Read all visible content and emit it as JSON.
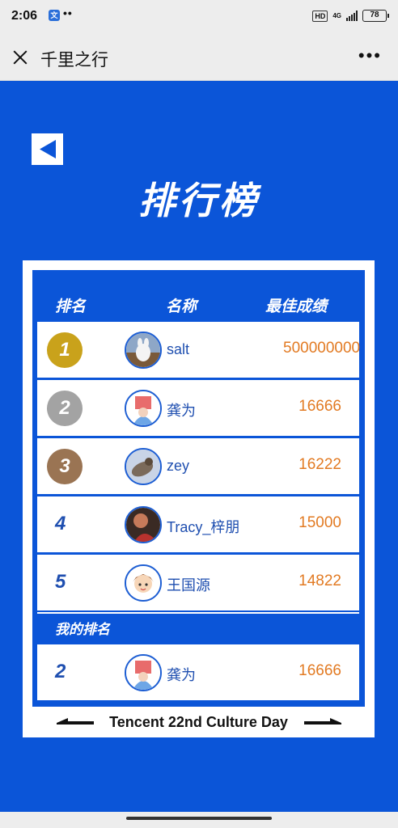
{
  "status": {
    "time": "2:06",
    "app_icon": "translate-icon",
    "dots": "••",
    "hd": "HD",
    "network": "4G",
    "battery": "78"
  },
  "titlebar": {
    "title": "千里之行",
    "close_icon": "close-icon",
    "more_icon": "more-icon",
    "more_label": "•••"
  },
  "page": {
    "heading": "排行榜",
    "back_icon": "back-arrow-icon"
  },
  "table": {
    "headers": {
      "rank": "排名",
      "name": "名称",
      "score": "最佳成绩"
    },
    "rows": [
      {
        "rank": "1",
        "name": "salt",
        "score": "500000000",
        "medal_color": "#c9a21b",
        "avatar": "white-rabbit-avatar"
      },
      {
        "rank": "2",
        "name": "龚为",
        "score": "16666",
        "medal_color": "#a3a3a3",
        "avatar": "cartoon-avatar"
      },
      {
        "rank": "3",
        "name": "zey",
        "score": "16222",
        "medal_color": "#9a7453",
        "avatar": "cat-photo-avatar"
      },
      {
        "rank": "4",
        "name": "Tracy_梓朋",
        "score": "15000",
        "avatar": "portrait-photo-avatar"
      },
      {
        "rank": "5",
        "name": "王国源",
        "score": "14822",
        "avatar": "anime-boy-avatar"
      }
    ]
  },
  "my_rank": {
    "label": "我的排名",
    "rank": "2",
    "name": "龚为",
    "score": "16666",
    "avatar": "cartoon-avatar"
  },
  "footer": {
    "text": "Tencent 22nd Culture Day"
  },
  "colors": {
    "background": "#0b55d8",
    "score": "#e27a22",
    "name": "#1f4fb0"
  }
}
